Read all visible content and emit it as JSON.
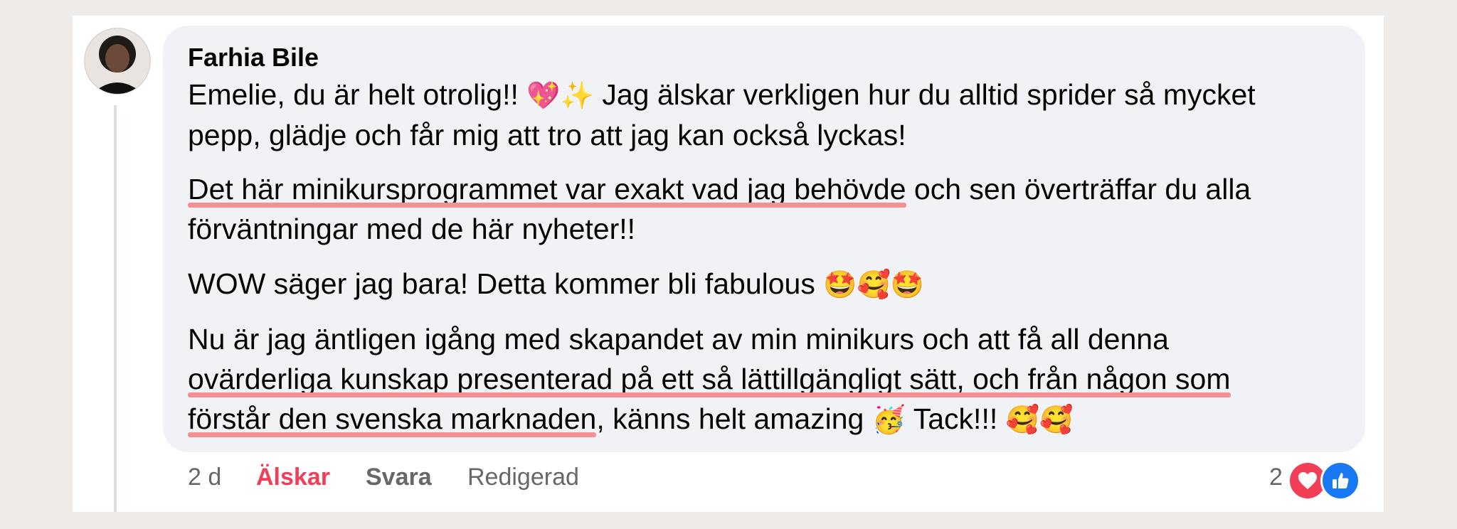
{
  "comment": {
    "author": "Farhia Bile",
    "paragraphs": {
      "p1": {
        "line1_a": "Emelie, du är helt otrolig!! ",
        "line1_emoji": "💖✨",
        "line1_b": " Jag älskar verkligen hur du alltid sprider så mycket",
        "line2": "pepp, glädje och får mig att tro att jag kan också lyckas!"
      },
      "p2": {
        "line1_underlined": "Det här minikursprogrammet var exakt vad jag behövde",
        "line1_rest": " och sen överträffar du alla",
        "line2": "förväntningar med de här nyheter!!"
      },
      "p3": {
        "text": "WOW säger jag bara! Detta kommer bli fabulous ",
        "emoji": "🤩🥰🤩"
      },
      "p4": {
        "line1": "Nu är jag äntligen igång med skapandet av min minikurs och att få all denna",
        "line2_underlined": "ovärderliga kunskap presenterad på ett så lättillgängligt sätt, och från någon som",
        "line3_underlined": "förstår den svenska marknaden",
        "line3_a": ", känns helt amazing ",
        "line3_emoji1": "🥳",
        "line3_b": " Tack!!! ",
        "line3_emoji2": "🥰🥰"
      }
    },
    "footer": {
      "time": "2 d",
      "love": "Älskar",
      "reply": "Svara",
      "edited": "Redigerad"
    },
    "reactions": {
      "count": "2",
      "types": [
        "heart-icon",
        "like-icon"
      ],
      "colors": {
        "heart": "#f33e58",
        "like": "#1877f2"
      }
    }
  }
}
